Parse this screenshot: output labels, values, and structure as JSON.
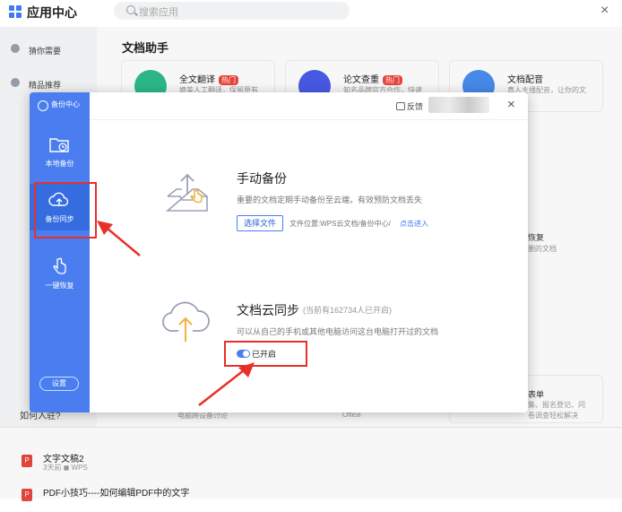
{
  "app": {
    "title": "应用中心",
    "search_placeholder": "搜索应用",
    "close_glyph": "×",
    "section_title": "文档助手",
    "hot_badge": "热门"
  },
  "sidebar": {
    "items": [
      {
        "label": "猜你需要"
      },
      {
        "label": "精品推荐"
      }
    ],
    "footer": "如何入驻?"
  },
  "cards": [
    {
      "title": "全文翻译",
      "desc": "媲美人工翻译，保留原有"
    },
    {
      "title": "论文查重",
      "desc": "知名品牌官方合作，快速"
    },
    {
      "title": "文档配音",
      "desc": "真人主播配音，让你的文"
    }
  ],
  "peek": {
    "right1": "恢复",
    "right2": "删的文档",
    "bottom_card_title": "表单",
    "bottom_card_desc1": "集、报名登记、问",
    "bottom_card_desc2": "卷调查轻松解决",
    "office": "Office",
    "left_bottom": "电脑跨设备讨论"
  },
  "recent_docs": [
    {
      "title": "文字文稿2",
      "time": "3天前",
      "source": "WPS"
    },
    {
      "title": "PDF小技巧----如何编辑PDF中的文字"
    }
  ],
  "dialog": {
    "brand": "备份中心",
    "nav": [
      {
        "label": "本地备份"
      },
      {
        "label": "备份同步"
      },
      {
        "label": "一键恢复"
      }
    ],
    "settings": "设置",
    "feedback": "反馈",
    "close_glyph": "×",
    "manual_backup": {
      "title": "手动备份",
      "desc": "重要的文档定期手动备份至云端，有效预防文档丢失",
      "choose_file": "选择文件",
      "file_location": "文件位置:WPS云文档/备份中心/",
      "click_enter": "点击进入"
    },
    "cloud_sync": {
      "title": "文档云同步",
      "count": "(当前有162734人已开启)",
      "desc": "可以从自己的手机或其他电脑访问这台电脑打开过的文档",
      "toggle_label": "已开启",
      "toggle_on": true
    }
  },
  "colors": {
    "accent": "#4a7ef0",
    "hot": "#f0463c",
    "annotation": "#e8302a",
    "upload_arrow": "#f3b23a"
  }
}
